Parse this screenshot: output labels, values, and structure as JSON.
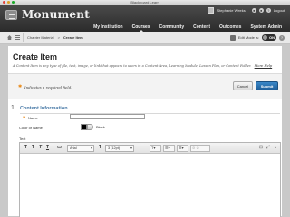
{
  "window": {
    "title": "Blackboard Learn"
  },
  "header": {
    "brand_name": "Monument",
    "user_name": "Stephanie Weeks",
    "logout_label": "Logout",
    "nav_tabs": [
      {
        "label": "My Institution",
        "active": false
      },
      {
        "label": "Courses",
        "active": true
      },
      {
        "label": "Community",
        "active": false
      },
      {
        "label": "Content",
        "active": false
      },
      {
        "label": "Outcomes",
        "active": false
      },
      {
        "label": "System Admin",
        "active": false
      }
    ]
  },
  "breadcrumb": {
    "items": [
      "Chapter Material"
    ],
    "separator": ">",
    "current": "Create Item",
    "edit_mode_label": "Edit Mode is:",
    "edit_mode_value": "ON"
  },
  "page": {
    "title": "Create Item",
    "description": "A Content Item is any type of file, text, image, or link that appears to users in a Content Area, Learning Module, Lesson Plan, or Content Folder.",
    "more_help": "More Help",
    "required_note": "Indicates a required field.",
    "cancel_label": "Cancel",
    "submit_label": "Submit"
  },
  "section": {
    "number": "1.",
    "title": "Content Information",
    "name_label": "Name",
    "name_value": "",
    "color_label": "Color of Name",
    "color_value": "Black",
    "text_label": "Text"
  },
  "editor": {
    "font_family": "Arial",
    "font_size": "3 (12pt)"
  },
  "colors": {
    "header_bg": "#2f2f2f",
    "accent_blue": "#2a6fb0",
    "required_orange": "#e88a1a",
    "section_title": "#4a7ba8"
  }
}
